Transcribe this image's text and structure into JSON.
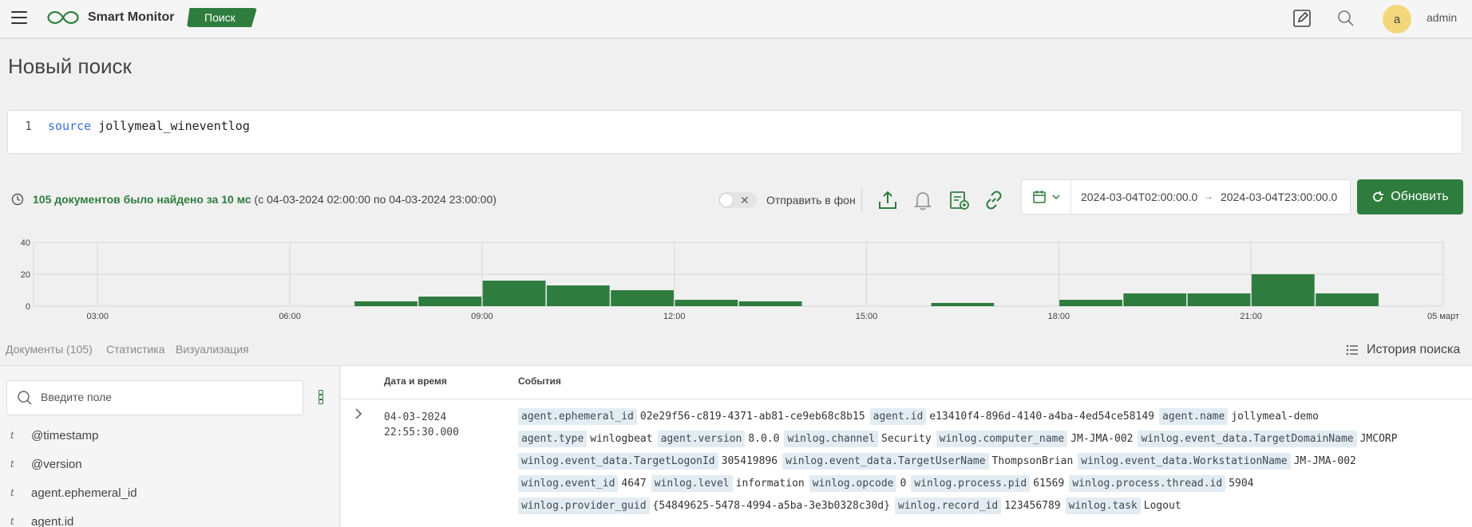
{
  "header": {
    "brand": "Smart Monitor",
    "active_tab": "Поиск",
    "user_initial": "a",
    "user_name": "admin"
  },
  "page": {
    "title": "Новый поиск"
  },
  "query": {
    "line_number": "1",
    "keyword": "source",
    "value": "jollymeal_wineventlog"
  },
  "results": {
    "found_text": "105 документов было найдено за 10 мс",
    "range_text": "(с 04-03-2024 02:00:00 по 04-03-2024 23:00:00)",
    "background_label": "Отправить в фон"
  },
  "daterange": {
    "from": "2024-03-04T02:00:00.0",
    "to": "2024-03-04T23:00:00.0",
    "arrow": "→"
  },
  "refresh_label": "Обновить",
  "chart_data": {
    "type": "bar",
    "y_ticks": [
      "0",
      "20",
      "40"
    ],
    "ylim": [
      0,
      40
    ],
    "x_ticks": [
      "03:00",
      "06:00",
      "09:00",
      "12:00",
      "15:00",
      "18:00",
      "21:00",
      "05 март"
    ],
    "bins_start_hour": 2,
    "bin_hours": 1,
    "values": [
      0,
      0,
      0,
      0,
      0,
      3,
      6,
      16,
      13,
      10,
      4,
      3,
      0,
      0,
      2,
      0,
      4,
      8,
      8,
      20,
      8,
      0
    ],
    "color": "#2e7d3e",
    "grid": true
  },
  "tabs": [
    {
      "label": "Документы (105)"
    },
    {
      "label": "Статистика"
    },
    {
      "label": "Визуализация"
    }
  ],
  "history_label": "История поиска",
  "field_search": {
    "placeholder": "Введите поле"
  },
  "fields": [
    {
      "type": "t",
      "name": "@timestamp"
    },
    {
      "type": "t",
      "name": "@version"
    },
    {
      "type": "t",
      "name": "agent.ephemeral_id"
    },
    {
      "type": "t",
      "name": "agent.id"
    }
  ],
  "table": {
    "col_datetime": "Дата и время",
    "col_events": "События",
    "rows": [
      {
        "date": "04-03-2024",
        "time": "22:55:30.000",
        "lines": [
          [
            [
              "agent.ephemeral_id",
              "02e29f56-c819-4371-ab81-ce9eb68c8b15"
            ],
            [
              "agent.id",
              "e13410f4-896d-4140-a4ba-4ed54ce58149"
            ],
            [
              "agent.name",
              "jollymeal-demo"
            ]
          ],
          [
            [
              "agent.type",
              "winlogbeat"
            ],
            [
              "agent.version",
              "8.0.0"
            ],
            [
              "winlog.channel",
              "Security"
            ],
            [
              "winlog.computer_name",
              "JM-JMA-002"
            ],
            [
              "winlog.event_data.TargetDomainName",
              "JMCORP"
            ]
          ],
          [
            [
              "winlog.event_data.TargetLogonId",
              "305419896"
            ],
            [
              "winlog.event_data.TargetUserName",
              "ThompsonBrian"
            ],
            [
              "winlog.event_data.WorkstationName",
              "JM-JMA-002"
            ]
          ],
          [
            [
              "winlog.event_id",
              "4647"
            ],
            [
              "winlog.level",
              "information"
            ],
            [
              "winlog.opcode",
              "0"
            ],
            [
              "winlog.process.pid",
              "61569"
            ],
            [
              "winlog.process.thread.id",
              "5904"
            ]
          ],
          [
            [
              "winlog.provider_guid",
              "{54849625-5478-4994-a5ba-3e3b0328c30d}"
            ],
            [
              "winlog.record_id",
              "123456789"
            ],
            [
              "winlog.task",
              "Logout"
            ]
          ]
        ]
      }
    ]
  }
}
